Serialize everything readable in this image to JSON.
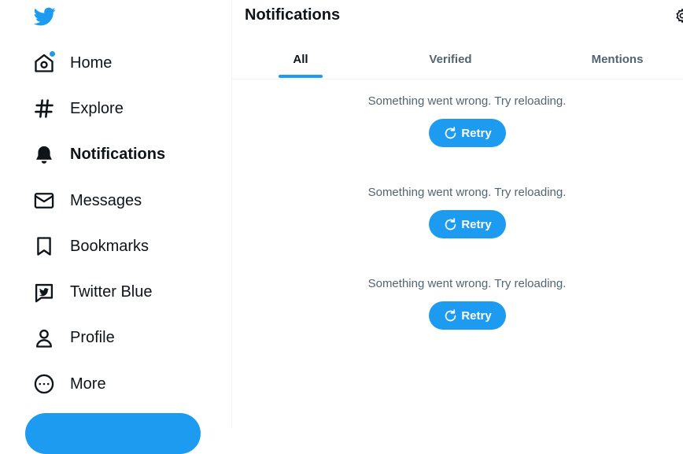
{
  "sidebar": {
    "logo": "twitter-bird-logo",
    "items": [
      {
        "label": "Home",
        "icon": "home-icon",
        "active": false,
        "has_dot": true
      },
      {
        "label": "Explore",
        "icon": "hashtag-icon",
        "active": false
      },
      {
        "label": "Notifications",
        "icon": "bell-icon",
        "active": true
      },
      {
        "label": "Messages",
        "icon": "envelope-icon",
        "active": false
      },
      {
        "label": "Bookmarks",
        "icon": "bookmark-icon",
        "active": false
      },
      {
        "label": "Twitter Blue",
        "icon": "twitter-blue-icon",
        "active": false
      },
      {
        "label": "Profile",
        "icon": "person-icon",
        "active": false
      },
      {
        "label": "More",
        "icon": "more-circle-icon",
        "active": false
      }
    ]
  },
  "header": {
    "title": "Notifications",
    "settings_icon": "gear-icon"
  },
  "tabs": [
    {
      "label": "All",
      "active": true
    },
    {
      "label": "Verified",
      "active": false
    },
    {
      "label": "Mentions",
      "active": false
    }
  ],
  "errors": [
    {
      "message": "Something went wrong. Try reloading.",
      "button": "Retry"
    },
    {
      "message": "Something went wrong. Try reloading.",
      "button": "Retry"
    },
    {
      "message": "Something went wrong. Try reloading.",
      "button": "Retry"
    }
  ],
  "colors": {
    "accent": "#1d9bf0",
    "text": "#0f1419",
    "secondary": "#536471",
    "border": "#eff3f4"
  }
}
